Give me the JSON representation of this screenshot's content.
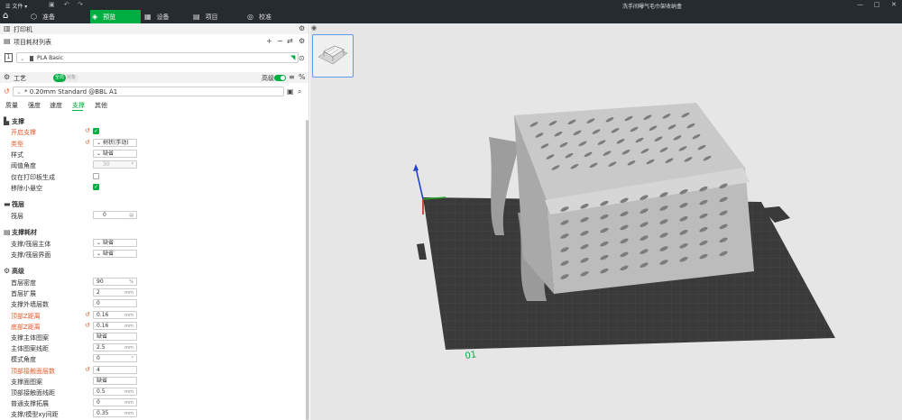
{
  "window": {
    "menu_label": "文件",
    "title": "洗手间曝气毛巾架收纳盒"
  },
  "tabs": [
    {
      "label": "准备",
      "icon": "cube-icon"
    },
    {
      "label": "预览",
      "icon": "preview-icon"
    },
    {
      "label": "设备",
      "icon": "device-icon"
    },
    {
      "label": "项目",
      "icon": "project-icon"
    },
    {
      "label": "校准",
      "icon": "calibrate-icon"
    }
  ],
  "printer": {
    "label": "打印机"
  },
  "filament": {
    "header": "项目耗材列表",
    "slot": "1",
    "name": "PLA Basic",
    "color": "#555555"
  },
  "process": {
    "label": "工艺",
    "toggle_on": "全局",
    "toggle_off": "对象",
    "advanced_label": "高级",
    "preset": "* 0.20mm Standard @BBL A1",
    "subtabs": [
      "质量",
      "强度",
      "速度",
      "支撑",
      "其他"
    ],
    "active_subtab": "支撑"
  },
  "support": {
    "title": "支撑",
    "enable": {
      "label": "开启支撑",
      "checked": true
    },
    "type": {
      "label": "类型",
      "value": "树状(手动)"
    },
    "style": {
      "label": "样式",
      "value": "缺省"
    },
    "threshold": {
      "label": "阈值角度",
      "value": "30"
    },
    "on_build_plate": {
      "label": "仅在打印板生成",
      "checked": false
    },
    "remove_small": {
      "label": "移除小悬空",
      "checked": true
    }
  },
  "raft": {
    "title": "筏层",
    "layers_label": "筏层",
    "layers_value": "0"
  },
  "support_filament": {
    "title": "支撑耗材",
    "base": {
      "label": "支撑/筏层主体",
      "value": "缺省"
    },
    "interface": {
      "label": "支撑/筏层界面",
      "value": "缺省"
    }
  },
  "advanced": {
    "title": "高级",
    "rows": [
      {
        "label": "首层密度",
        "value": "90",
        "unit": "%",
        "changed": false
      },
      {
        "label": "首层扩展",
        "value": "2",
        "unit": "mm",
        "changed": false
      },
      {
        "label": "支撑外墙层数",
        "value": "0",
        "unit": "",
        "changed": false
      },
      {
        "label": "顶部Z距离",
        "value": "0.16",
        "unit": "mm",
        "changed": true
      },
      {
        "label": "底部Z距离",
        "value": "0.16",
        "unit": "mm",
        "changed": true
      },
      {
        "label": "支撑主体图案",
        "value": "缺省",
        "unit": "",
        "changed": false
      },
      {
        "label": "主体图案线距",
        "value": "2.5",
        "unit": "mm",
        "changed": false
      },
      {
        "label": "模式角度",
        "value": "0",
        "unit": "°",
        "changed": false
      },
      {
        "label": "顶部接触面层数",
        "value": "4",
        "unit": "",
        "changed": true
      },
      {
        "label": "支撑面图案",
        "value": "缺省",
        "unit": "",
        "changed": false
      },
      {
        "label": "顶部接触面线距",
        "value": "0.5",
        "unit": "mm",
        "changed": false
      },
      {
        "label": "普通支撑拓展",
        "value": "0",
        "unit": "mm",
        "changed": false
      },
      {
        "label": "支撑/模型xy间距",
        "value": "0.35",
        "unit": "mm",
        "changed": false
      }
    ]
  },
  "viewport": {
    "plate_number": "01",
    "tab_icon": "eye-icon"
  },
  "colors": {
    "accent": "#00ae42",
    "changed": "#e05d2c",
    "bar": "#262b30",
    "plate": "#3a3a3a"
  }
}
